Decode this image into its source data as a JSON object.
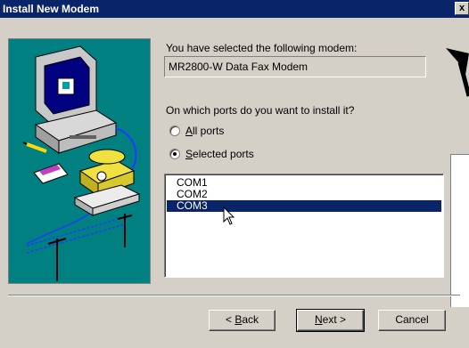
{
  "window": {
    "title": "Install New Modem",
    "close_glyph": "x"
  },
  "content": {
    "selected_label": "You have selected the following modem:",
    "modem_name": "MR2800-W Data Fax Modem",
    "ports_question": "On which ports do you want to install it?"
  },
  "radio": {
    "all": {
      "prefix": "",
      "accel": "A",
      "rest": "ll ports",
      "checked": false
    },
    "selected": {
      "prefix": "",
      "accel": "S",
      "rest": "elected ports",
      "checked": true
    }
  },
  "ports": [
    {
      "label": "COM1",
      "selected": false
    },
    {
      "label": "COM2",
      "selected": false
    },
    {
      "label": "COM3",
      "selected": true
    }
  ],
  "buttons": {
    "back": {
      "prefix": "< ",
      "accel": "B",
      "rest": "ack"
    },
    "next": {
      "prefix": "",
      "accel": "N",
      "rest": "ext >"
    },
    "cancel": "Cancel"
  },
  "colors": {
    "titlebar": "#0a246a",
    "dialog_bg": "#d4d0c8",
    "illustration_bg": "#008080",
    "selection": "#0a246a"
  },
  "icons": [
    "close-icon",
    "computer-icon",
    "telephone-icon",
    "modem-icon",
    "utility-pole-icon",
    "mouse-cursor-icon",
    "arrow-icon"
  ]
}
